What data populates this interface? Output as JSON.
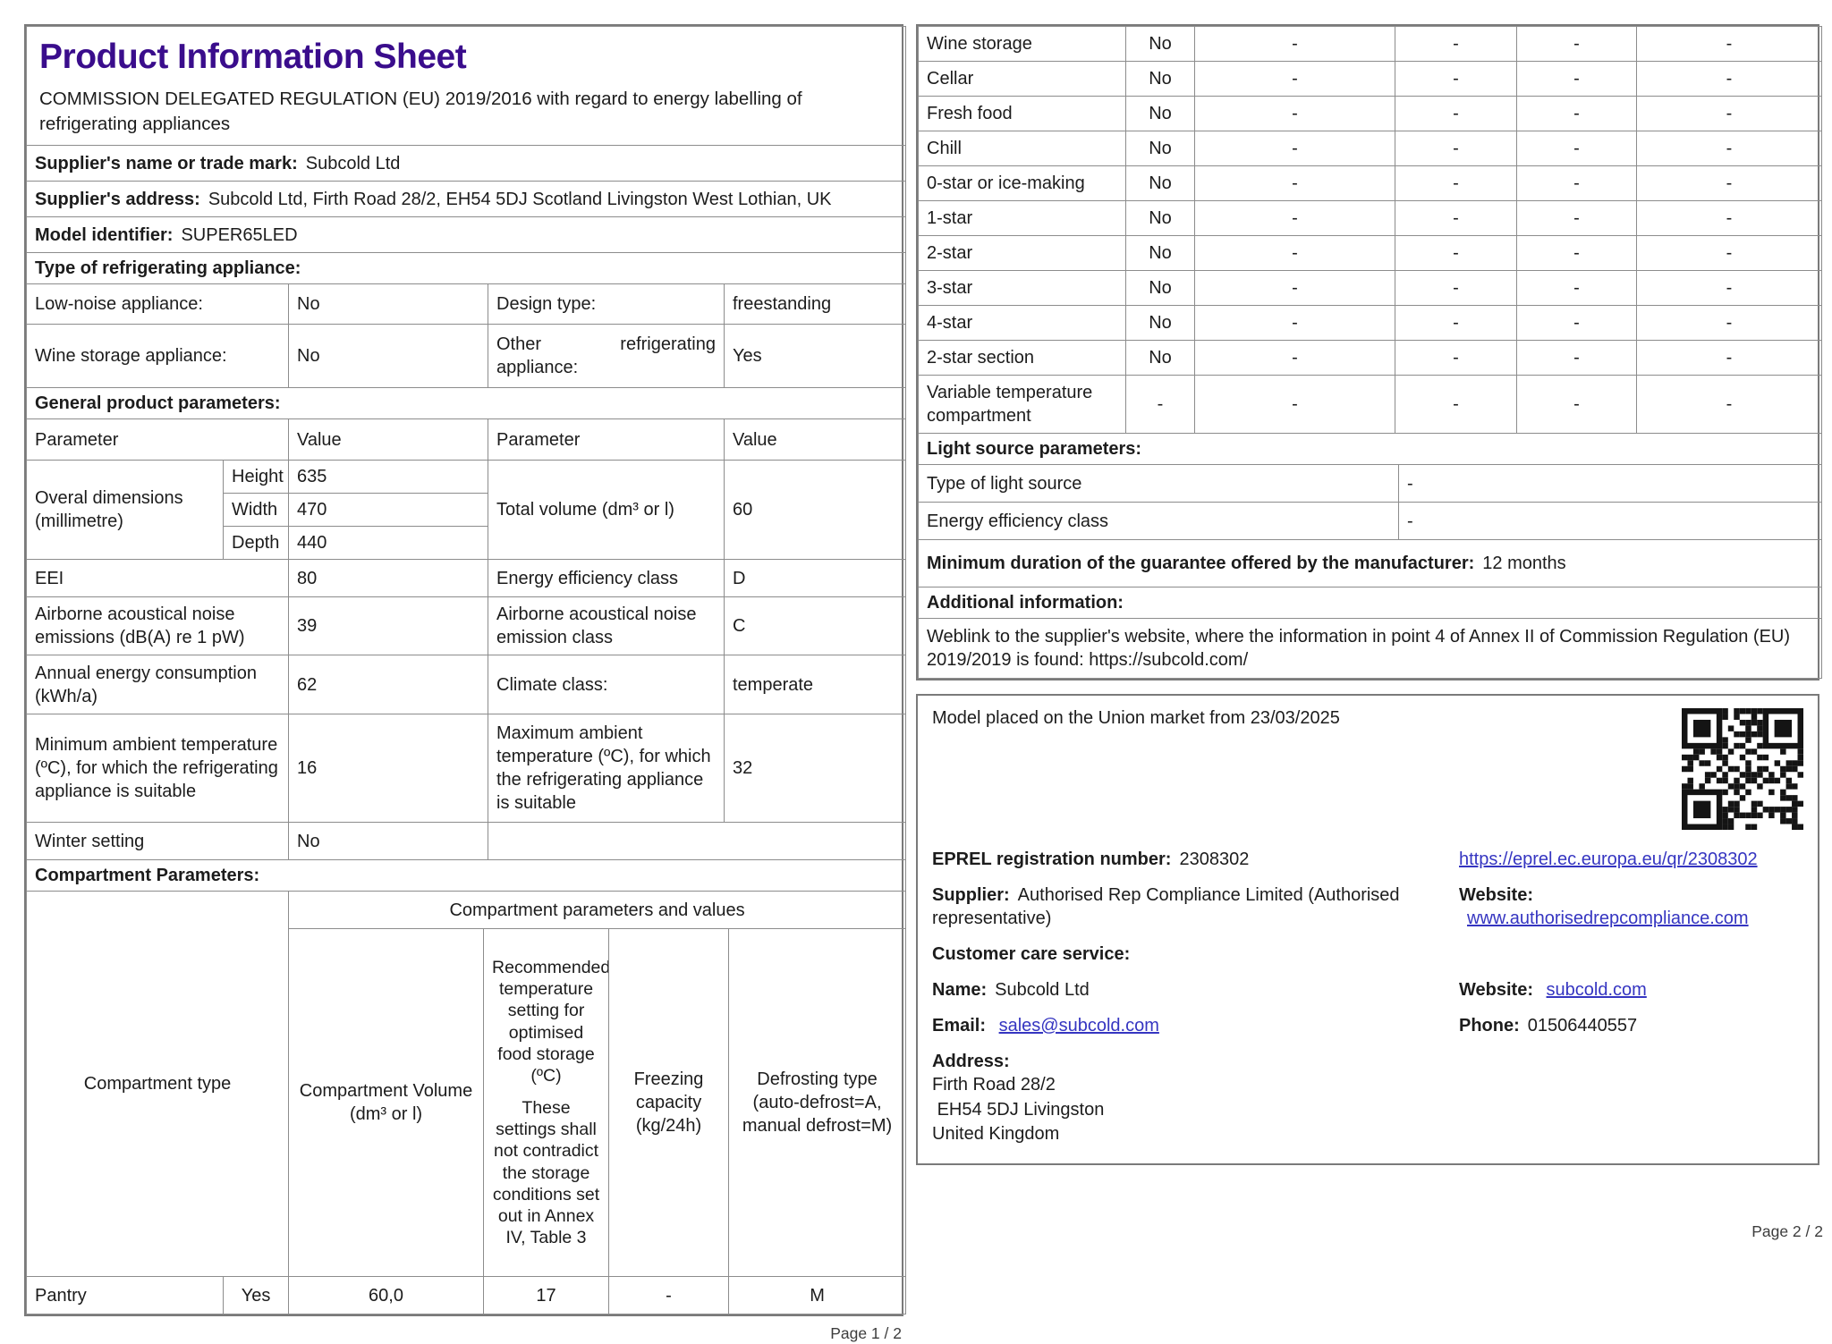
{
  "page1": {
    "title": "Product Information Sheet",
    "subtitle": "COMMISSION DELEGATED REGULATION (EU) 2019/2016 with regard to energy labelling of refrigerating appliances",
    "supplier_name_label": "Supplier's name or trade mark:",
    "supplier_name_value": "Subcold Ltd",
    "supplier_address_label": "Supplier's address:",
    "supplier_address_value": "Subcold Ltd, Firth Road 28/2, EH54 5DJ Scotland Livingston West Lothian, UK",
    "model_identifier_label": "Model identifier:",
    "model_identifier_value": "SUPER65LED",
    "type_section_title": "Type of refrigerating appliance:",
    "type_rows": [
      {
        "label1": "Low-noise appliance:",
        "value1": "No",
        "label2": "Design type:",
        "value2": "freestanding"
      },
      {
        "label1": "Wine storage appliance:",
        "value1": "No",
        "label2": "Other refrigerating appliance:",
        "value2": "Yes"
      }
    ],
    "general_section_title": "General product parameters:",
    "param_header": {
      "c1": "Parameter",
      "c2": "Value",
      "c3": "Parameter",
      "c4": "Value"
    },
    "dimensions": {
      "label": "Overal dimensions (millimetre)",
      "rows": [
        {
          "name": "Height",
          "value": "635"
        },
        {
          "name": "Width",
          "value": "470"
        },
        {
          "name": "Depth",
          "value": "440"
        }
      ],
      "right_label": "Total volume (dm³ or l)",
      "right_value": "60"
    },
    "general_rows": [
      {
        "label1": "EEI",
        "value1": "80",
        "label2": "Energy efficiency class",
        "value2": "D"
      },
      {
        "label1": "Airborne acoustical noise emissions (dB(A) re 1 pW)",
        "value1": "39",
        "label2": "Airborne acoustical noise emission class",
        "value2": "C"
      },
      {
        "label1": "Annual energy consumption (kWh/a)",
        "value1": "62",
        "label2": "Climate class:",
        "value2": "temperate"
      },
      {
        "label1": "Minimum ambient temperature (ºC), for which the refrigerating appliance is suitable",
        "value1": "16",
        "label2": "Maximum ambient temperature (ºC), for which the refrigerating appliance is suitable",
        "value2": "32"
      },
      {
        "label1": "Winter setting",
        "value1": "No"
      }
    ],
    "compartment_section_title": "Compartment Parameters:",
    "compartment_table": {
      "type_header": "Compartment type",
      "group_header": "Compartment parameters and values",
      "col_volume": "Compartment Volume (dm³ or l)",
      "col_temp_p1": "Recommended temperature setting for optimised food storage (ºC)",
      "col_temp_p2": "These settings shall not contradict the storage conditions set out in Annex IV, Table 3",
      "col_freezing": "Freezing capacity (kg/24h)",
      "col_defrost": "Defrosting type (auto-defrost=A, manual defrost=M)",
      "row": {
        "type": "Pantry",
        "present": "Yes",
        "volume": "60,0",
        "temp": "17",
        "freezing": "-",
        "defrost": "M"
      }
    },
    "page_footer": "Page 1 / 2"
  },
  "page2": {
    "compartment_rows": [
      {
        "label": "Wine storage",
        "cells": [
          "No",
          "-",
          "-",
          "-",
          "-"
        ]
      },
      {
        "label": "Cellar",
        "cells": [
          "No",
          "-",
          "-",
          "-",
          "-"
        ]
      },
      {
        "label": "Fresh food",
        "cells": [
          "No",
          "-",
          "-",
          "-",
          "-"
        ]
      },
      {
        "label": "Chill",
        "cells": [
          "No",
          "-",
          "-",
          "-",
          "-"
        ]
      },
      {
        "label": "0-star or ice-making",
        "cells": [
          "No",
          "-",
          "-",
          "-",
          "-"
        ]
      },
      {
        "label": "1-star",
        "cells": [
          "No",
          "-",
          "-",
          "-",
          "-"
        ]
      },
      {
        "label": "2-star",
        "cells": [
          "No",
          "-",
          "-",
          "-",
          "-"
        ]
      },
      {
        "label": "3-star",
        "cells": [
          "No",
          "-",
          "-",
          "-",
          "-"
        ]
      },
      {
        "label": "4-star",
        "cells": [
          "No",
          "-",
          "-",
          "-",
          "-"
        ]
      },
      {
        "label": "2-star section",
        "cells": [
          "No",
          "-",
          "-",
          "-",
          "-"
        ]
      },
      {
        "label": "Variable temperature compartment",
        "cells": [
          "-",
          "-",
          "-",
          "-",
          "-"
        ]
      }
    ],
    "light_section_title": "Light source parameters:",
    "light_rows": [
      {
        "label": "Type of light source",
        "value": "-"
      },
      {
        "label": "Energy efficiency class",
        "value": "-"
      }
    ],
    "guarantee_label": "Minimum duration of the guarantee offered by the manufacturer:",
    "guarantee_value": "12 months",
    "additional_title": "Additional information:",
    "weblink_text": "Weblink to the supplier's website, where the information in point 4 of Annex II of Commission Regulation (EU) 2019/2019 is found:",
    "weblink_url": "https://subcold.com/",
    "box": {
      "market_text": "Model placed on the Union market from 23/03/2025",
      "eprel_label": "EPREL registration number:",
      "eprel_value": "2308302",
      "eprel_link": "https://eprel.ec.europa.eu/qr/2308302",
      "supplier_label": "Supplier:",
      "supplier_value": "Authorised Rep Compliance Limited (Authorised representative)",
      "website_label": "Website:",
      "website_link": "www.authorisedrepcompliance.com",
      "care_title": "Customer care service:",
      "name_label": "Name:",
      "name_value": "Subcold Ltd",
      "care_website_label": "Website:",
      "care_website_link": "subcold.com",
      "email_label": "Email:",
      "email_link": "sales@subcold.com",
      "phone_label": "Phone:",
      "phone_value": "01506440557",
      "address_label": "Address:",
      "address_lines": [
        "Firth Road 28/2",
        " EH54 5DJ Livingston",
        "United Kingdom"
      ]
    },
    "page_footer": "Page 2 / 2"
  },
  "colors": {
    "title": "#3a0d8c",
    "link": "#3535c1",
    "border": "#8c8c8c"
  }
}
